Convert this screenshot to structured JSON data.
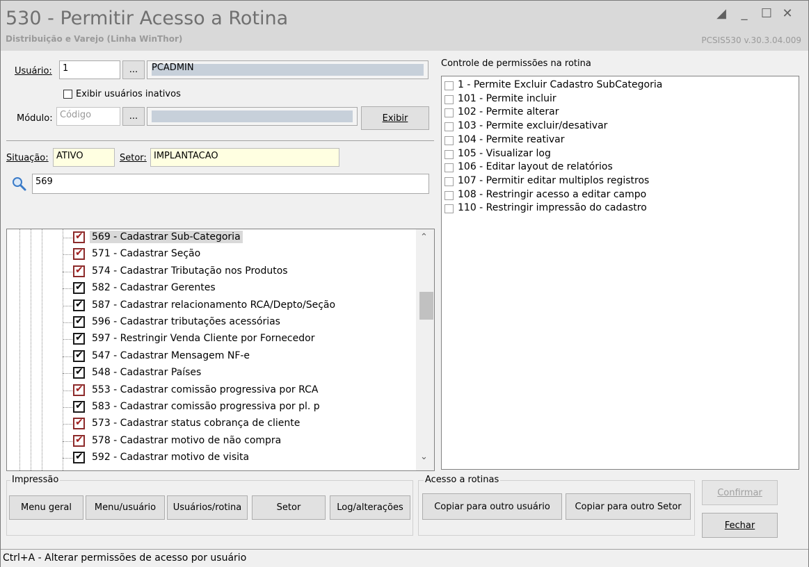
{
  "window": {
    "title": "530 - Permitir Acesso a Rotina",
    "subtitle": "Distribuição e Varejo (Linha WinThor)",
    "version": "PCSIS530  v.30.3.04.009"
  },
  "user": {
    "label": "Usuário:",
    "code": "1",
    "browse": "...",
    "name": "PCADMIN",
    "show_inactive_label": "Exibir usuários inativos"
  },
  "module": {
    "label": "Módulo:",
    "code_placeholder": "Código",
    "browse": "...",
    "show_button": "Exibir"
  },
  "situation": {
    "label": "Situação:",
    "value": "ATIVO"
  },
  "sector": {
    "label": "Setor:",
    "value": "IMPLANTACAO"
  },
  "search": {
    "value": "569"
  },
  "tree_items": [
    {
      "label": "569 - Cadastrar Sub-Categoria",
      "checked": true,
      "mark": "red",
      "selected": true
    },
    {
      "label": "571 - Cadastrar Seção",
      "checked": true,
      "mark": "red",
      "selected": false
    },
    {
      "label": "574 - Cadastrar Tributação nos Produtos",
      "checked": true,
      "mark": "red",
      "selected": false
    },
    {
      "label": "582 - Cadastrar Gerentes",
      "checked": true,
      "mark": "black",
      "selected": false
    },
    {
      "label": "587 - Cadastrar relacionamento RCA/Depto/Seção",
      "checked": true,
      "mark": "black",
      "selected": false
    },
    {
      "label": "596 - Cadastrar tributações acessórias",
      "checked": true,
      "mark": "black",
      "selected": false
    },
    {
      "label": "597 - Restringir Venda Cliente por Fornecedor",
      "checked": true,
      "mark": "black",
      "selected": false
    },
    {
      "label": "547 - Cadastrar Mensagem NF-e",
      "checked": true,
      "mark": "black",
      "selected": false
    },
    {
      "label": "548 - Cadastrar Países",
      "checked": true,
      "mark": "black",
      "selected": false
    },
    {
      "label": "553 - Cadastrar comissão progressiva por RCA",
      "checked": true,
      "mark": "red",
      "selected": false
    },
    {
      "label": "583 - Cadastrar comissão progressiva por pl. p",
      "checked": true,
      "mark": "black",
      "selected": false
    },
    {
      "label": "573 - Cadastrar status cobrança de cliente",
      "checked": true,
      "mark": "red",
      "selected": false
    },
    {
      "label": "578 - Cadastrar motivo de não compra",
      "checked": true,
      "mark": "red",
      "selected": false
    },
    {
      "label": "592 - Cadastrar motivo de visita",
      "checked": true,
      "mark": "black",
      "selected": false
    }
  ],
  "permissions": {
    "title": "Controle de permissões na rotina",
    "items": [
      "1 - Permite Excluir Cadastro SubCategoria",
      "101 - Permite incluir",
      "102 - Permite alterar",
      "103 - Permite excluir/desativar",
      "104 - Permite reativar",
      "105 - Visualizar log",
      "106 - Editar layout de relatórios",
      "107 - Permitir editar multiplos registros",
      "108 - Restringir acesso a editar campo",
      "110 - Restringir impressão do cadastro"
    ]
  },
  "print_group": {
    "title": "Impressão",
    "buttons": [
      "Menu geral",
      "Menu/usuário",
      "Usuários/rotina",
      "Setor",
      "Log/alterações"
    ]
  },
  "access_group": {
    "title": "Acesso a rotinas",
    "buttons": [
      "Copiar para outro usuário",
      "Copiar para outro Setor"
    ]
  },
  "actions": {
    "confirm": "Confirmar",
    "close": "Fechar"
  },
  "status": "Ctrl+A - Alterar permissões de acesso por usuário"
}
